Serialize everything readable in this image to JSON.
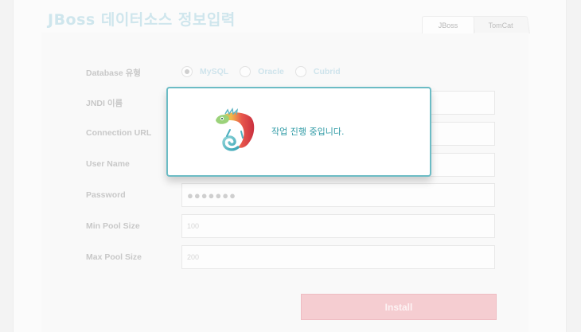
{
  "page": {
    "title": "JBoss 데이터소스 정보입력"
  },
  "tabs": [
    {
      "label": "JBoss",
      "active": true
    },
    {
      "label": "TomCat",
      "active": false
    }
  ],
  "form": {
    "db_type": {
      "label": "Database 유형",
      "options": [
        "MySQL",
        "Oracle",
        "Cubrid"
      ],
      "selected": "MySQL"
    },
    "jndi": {
      "label": "JNDI 이름",
      "value": ""
    },
    "conn_url": {
      "label": "Connection URL",
      "value": ""
    },
    "user_name": {
      "label": "User Name",
      "value": ""
    },
    "password": {
      "label": "Password",
      "value": "●●●●●●●"
    },
    "min_pool": {
      "label": "Min Pool Size",
      "value": "100"
    },
    "max_pool": {
      "label": "Max Pool Size",
      "value": "200"
    }
  },
  "install_button": {
    "label": "Install"
  },
  "modal": {
    "message": "작업 진행 중입니다.",
    "icon": "chameleon-logo-icon"
  },
  "colors": {
    "modal_border": "#6cbcc5",
    "modal_text": "#2e9aa5",
    "install_button": "#f5cdd1"
  }
}
